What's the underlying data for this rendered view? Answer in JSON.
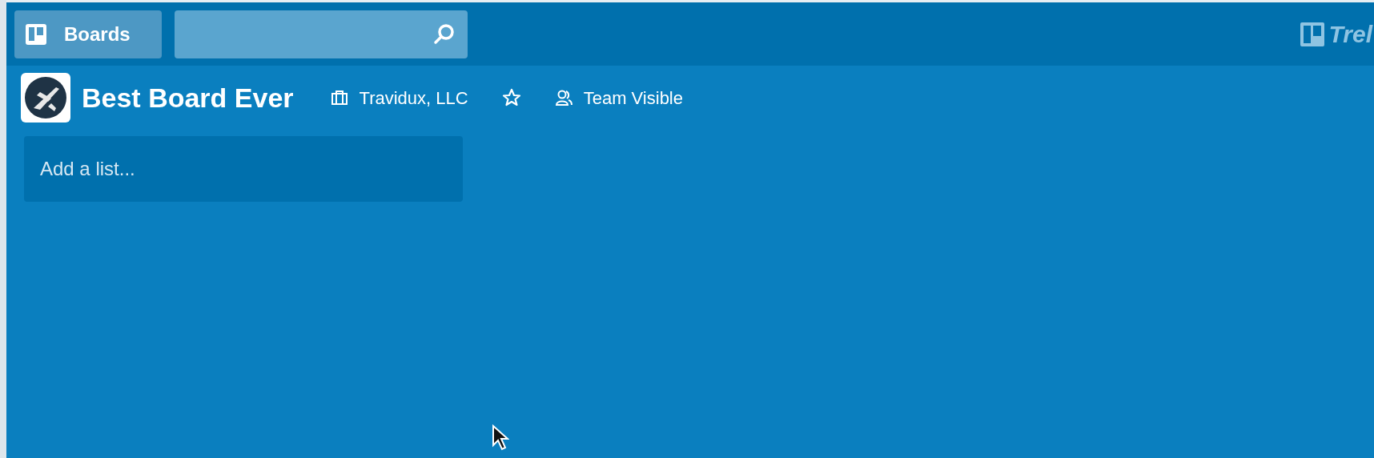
{
  "header": {
    "boards_button": "Boards",
    "logo_text": "Trel"
  },
  "board": {
    "title": "Best Board Ever",
    "team": "Travidux, LLC",
    "starred": false,
    "visibility": "Team Visible"
  },
  "add_list": {
    "placeholder": "Add a list..."
  }
}
